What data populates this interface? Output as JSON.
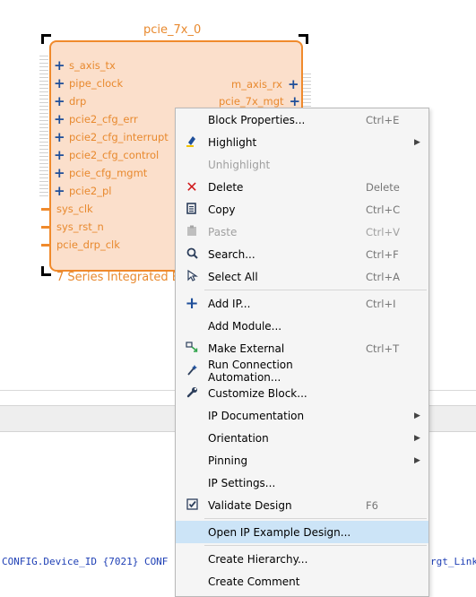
{
  "block": {
    "name": "pcie_7x_0",
    "subtitle": "7 Series Integrated B",
    "left_ports": [
      "s_axis_tx",
      "pipe_clock",
      "drp",
      "pcie2_cfg_err",
      "pcie2_cfg_interrupt",
      "pcie2_cfg_control",
      "pcie_cfg_mgmt",
      "pcie2_pl"
    ],
    "clock_ports": [
      "sys_clk",
      "sys_rst_n",
      "pcie_drp_clk"
    ],
    "right_ports": [
      "m_axis_rx",
      "pcie_7x_mgt"
    ]
  },
  "tcl_console": {
    "line_left": "CONFIG.Device_ID {7021} CONF",
    "line_right": "rgt_Link"
  },
  "context_menu": {
    "items": [
      {
        "label": "Block Properties...",
        "shortcut": "Ctrl+E",
        "icon": "none"
      },
      {
        "label": "Highlight",
        "shortcut": "",
        "icon": "highlight-brush-icon",
        "submenu": true
      },
      {
        "label": "Unhighlight",
        "shortcut": "",
        "icon": "none",
        "disabled": true
      },
      {
        "label": "Delete",
        "shortcut": "Delete",
        "icon": "delete-x-icon"
      },
      {
        "label": "Copy",
        "shortcut": "Ctrl+C",
        "icon": "copy-icon"
      },
      {
        "label": "Paste",
        "shortcut": "Ctrl+V",
        "icon": "paste-icon",
        "disabled": true
      },
      {
        "label": "Search...",
        "shortcut": "Ctrl+F",
        "icon": "search-icon"
      },
      {
        "label": "Select All",
        "shortcut": "Ctrl+A",
        "icon": "select-all-icon"
      },
      {
        "label": "Add IP...",
        "shortcut": "Ctrl+I",
        "icon": "add-icon"
      },
      {
        "label": "Add Module...",
        "shortcut": "",
        "icon": "none"
      },
      {
        "label": "Make External",
        "shortcut": "Ctrl+T",
        "icon": "make-external-icon"
      },
      {
        "label": "Run Connection Automation...",
        "shortcut": "",
        "icon": "wand-icon"
      },
      {
        "label": "Customize Block...",
        "shortcut": "",
        "icon": "wrench-icon"
      },
      {
        "label": "IP Documentation",
        "shortcut": "",
        "icon": "none",
        "submenu": true
      },
      {
        "label": "Orientation",
        "shortcut": "",
        "icon": "none",
        "submenu": true
      },
      {
        "label": "Pinning",
        "shortcut": "",
        "icon": "none",
        "submenu": true
      },
      {
        "label": "IP Settings...",
        "shortcut": "",
        "icon": "none"
      },
      {
        "label": "Validate Design",
        "shortcut": "F6",
        "icon": "validate-check-icon"
      },
      {
        "label": "Open IP Example Design...",
        "shortcut": "",
        "icon": "none",
        "selected": true
      },
      {
        "label": "Create Hierarchy...",
        "shortcut": "",
        "icon": "none"
      },
      {
        "label": "Create Comment",
        "shortcut": "",
        "icon": "none"
      }
    ]
  },
  "colors": {
    "block_fill": "#fbdfcb",
    "block_border": "#f08a2c",
    "port_text": "#e8892e",
    "selection": "#cce4f7"
  }
}
